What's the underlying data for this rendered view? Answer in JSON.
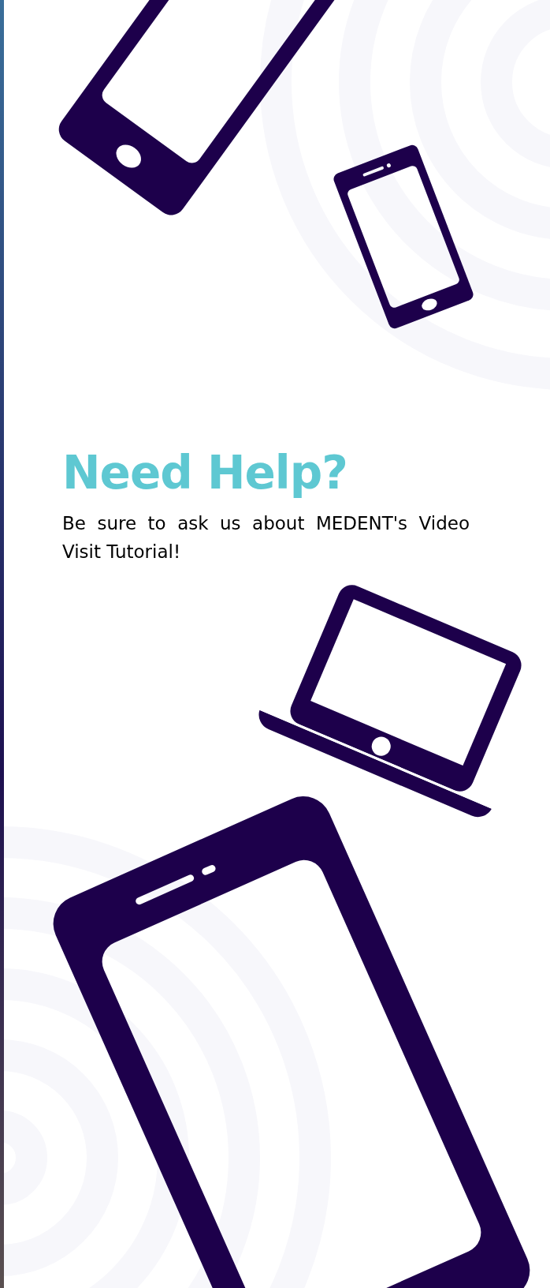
{
  "heading": "Need Help?",
  "body": "Be sure to ask us about MEDENT's Video Visit Tutorial!"
}
